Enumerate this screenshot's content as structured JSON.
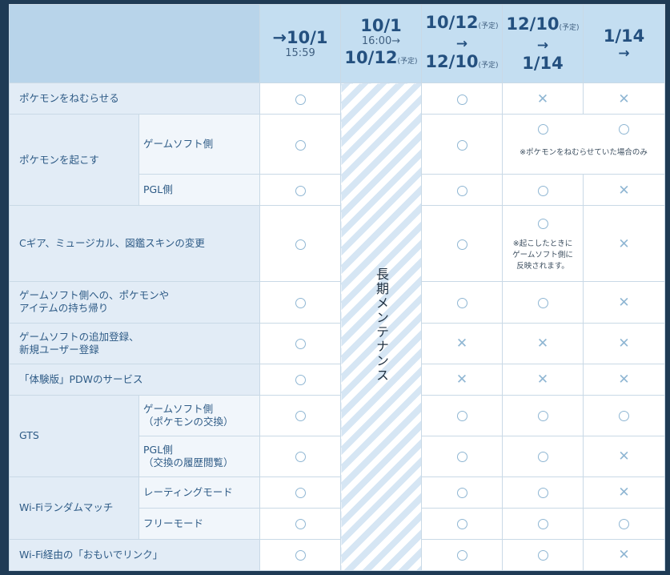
{
  "header": {
    "col1": {
      "big": "→10/1",
      "small": "15:59"
    },
    "col2": {
      "top": "10/1",
      "mid": "16:00→",
      "big": "10/12",
      "tag": "(予定)"
    },
    "col3": {
      "big1": "10/12",
      "tag1": "(予定)",
      "arrow": "→",
      "big2": "12/10",
      "tag2": "(予定)"
    },
    "col4": {
      "big1": "12/10",
      "tag1": "(予定)",
      "arrow": "→",
      "big2": "1/14"
    },
    "col5": {
      "big": "1/14",
      "arrow": "→"
    }
  },
  "maintenance_label": "長期メンテナンス",
  "notes": {
    "sleep_only": "※ポケモンをねむらせていた場合のみ",
    "reflect_line1": "※起こしたときに",
    "reflect_line2": "ゲームソフト側に",
    "reflect_line3": "反映されます。"
  },
  "rows": [
    {
      "label": "ポケモンをねむらせる",
      "sub": "",
      "values": [
        "o",
        "o",
        "x",
        "x"
      ]
    },
    {
      "label": "ポケモンを起こす",
      "sub": "ゲームソフト側",
      "values": [
        "o",
        "o",
        "o",
        "o"
      ]
    },
    {
      "label": "",
      "sub": "PGL側",
      "values": [
        "o",
        "o",
        "o",
        "x"
      ]
    },
    {
      "label": "Cギア、ミュージカル、図鑑スキンの変更",
      "sub": "",
      "values": [
        "o",
        "o",
        "o",
        "x"
      ]
    },
    {
      "label_line1": "ゲームソフト側への、ポケモンや",
      "label_line2": "アイテムの持ち帰り",
      "values": [
        "o",
        "o",
        "o",
        "x"
      ]
    },
    {
      "label_line1": "ゲームソフトの追加登録、",
      "label_line2": "新規ユーザー登録",
      "values": [
        "o",
        "x",
        "x",
        "x"
      ]
    },
    {
      "label": "「体験版」PDWのサービス",
      "sub": "",
      "values": [
        "o",
        "x",
        "x",
        "x"
      ]
    },
    {
      "label": "GTS",
      "sub_line1": "ゲームソフト側",
      "sub_line2": "（ポケモンの交換）",
      "values": [
        "o",
        "o",
        "o",
        "o"
      ]
    },
    {
      "label": "",
      "sub_line1": "PGL側",
      "sub_line2": "（交換の履歴閲覧）",
      "values": [
        "o",
        "o",
        "o",
        "x"
      ]
    },
    {
      "label": "Wi-Fiランダムマッチ",
      "sub": "レーティングモード",
      "values": [
        "o",
        "o",
        "o",
        "x"
      ]
    },
    {
      "label": "",
      "sub": "フリーモード",
      "values": [
        "o",
        "o",
        "o",
        "o"
      ]
    },
    {
      "label": "Wi-Fi経由の「おもいでリンク」",
      "sub": "",
      "values": [
        "o",
        "o",
        "o",
        "x"
      ]
    }
  ],
  "colors": {
    "header_bg": "#c4def1",
    "label_bg": "#e2ecf6",
    "mark": "#8fb6d3",
    "frame": "#1f3b55"
  }
}
